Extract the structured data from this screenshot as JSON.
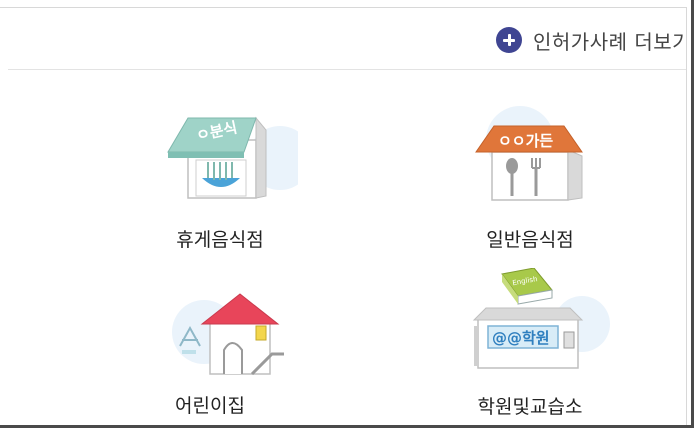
{
  "header": {
    "link_label": "인허가사례 더보기",
    "link_icon": "plus-circle-icon"
  },
  "categories": [
    {
      "label": "휴게음식점",
      "sign": "ㅇ분식",
      "icon": "snack-shop-icon"
    },
    {
      "label": "일반음식점",
      "sign": "ㅇㅇ가든",
      "icon": "restaurant-icon"
    },
    {
      "label": "어린이집",
      "sign": "",
      "icon": "daycare-icon"
    },
    {
      "label": "학원및교습소",
      "sign": "@@학원",
      "book": "English",
      "icon": "academy-icon"
    }
  ],
  "colors": {
    "accent": "#3f4592",
    "mint_roof": "#9fd3c8",
    "orange_roof": "#e0763a",
    "red_roof": "#e8455a",
    "green_book": "#a8c94a"
  }
}
